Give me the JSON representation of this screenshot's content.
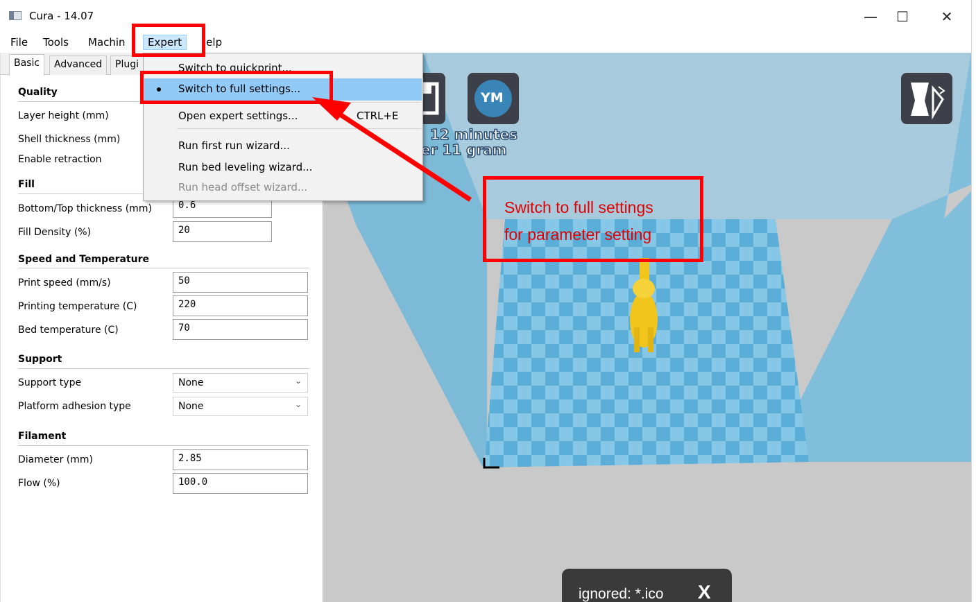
{
  "window": {
    "title": "Cura - 14.07",
    "minimize_glyph": "—",
    "maximize_glyph": "☐",
    "close_glyph": "✕"
  },
  "menubar": {
    "items": [
      "File",
      "Tools",
      "Machine",
      "Expert",
      "Help"
    ],
    "file": "File",
    "tools": "Tools",
    "machine": "Machin",
    "expert": "Expert",
    "help": "Help",
    "help_visible": "lelp"
  },
  "tabs": {
    "basic": "Basic",
    "advanced": "Advanced",
    "plugins": "Plugi"
  },
  "settings": {
    "quality": {
      "title": "Quality",
      "layer_height_label": "Layer height (mm)",
      "shell_thickness_label": "Shell thickness (mm)",
      "enable_retraction_label": "Enable retraction"
    },
    "fill": {
      "title": "Fill",
      "bottom_top_label": "Bottom/Top thickness (mm)",
      "bottom_top_value": "0.6",
      "density_label": "Fill Density (%)",
      "density_value": "20"
    },
    "speed": {
      "title": "Speed and Temperature",
      "print_speed_label": "Print speed (mm/s)",
      "print_speed_value": "50",
      "print_temp_label": "Printing temperature (C)",
      "print_temp_value": "220",
      "bed_temp_label": "Bed temperature (C)",
      "bed_temp_value": "70"
    },
    "support": {
      "title": "Support",
      "support_type_label": "Support type",
      "support_type_value": "None",
      "adhesion_label": "Platform adhesion type",
      "adhesion_value": "None"
    },
    "filament": {
      "title": "Filament",
      "diameter_label": "Diameter (mm)",
      "diameter_value": "2.85",
      "flow_label": "Flow (%)",
      "flow_value": "100.0"
    }
  },
  "expert_menu": {
    "items": [
      {
        "label": "Switch to quickprint...",
        "shortcut": ""
      },
      {
        "label": "Switch to full settings...",
        "shortcut": "",
        "selected": true
      },
      {
        "label": "Open expert settings...",
        "shortcut": "CTRL+E"
      },
      {
        "label": "Run first run wizard...",
        "shortcut": ""
      },
      {
        "label": "Run bed leveling wizard...",
        "shortcut": ""
      },
      {
        "label": "Run head offset wizard...",
        "shortcut": "",
        "disabled": true
      }
    ],
    "quickprint": "Switch to quickprint...",
    "full_settings": "Switch to full settings...",
    "expert_settings": "Open expert settings...",
    "expert_shortcut": "CTRL+E",
    "first_run": "Run first run wizard...",
    "bed_leveling": "Run bed leveling wizard...",
    "head_offset": "Run head offset wizard..."
  },
  "viewport": {
    "ym_label": "YM",
    "time_text": "12 minutes",
    "weight_text": "er 11 gram"
  },
  "annotation": {
    "line1": "Switch to full settings",
    "line2": "for parameter setting"
  },
  "toast": {
    "text": "ignored: *.ico",
    "close": "X"
  },
  "colors": {
    "highlight": "#91c9f7",
    "annotation_red": "#ff0000",
    "viewport_bg": "#c9c9c9",
    "build_volume": "#7fbfe0",
    "model_yellow": "#f2c51c"
  }
}
